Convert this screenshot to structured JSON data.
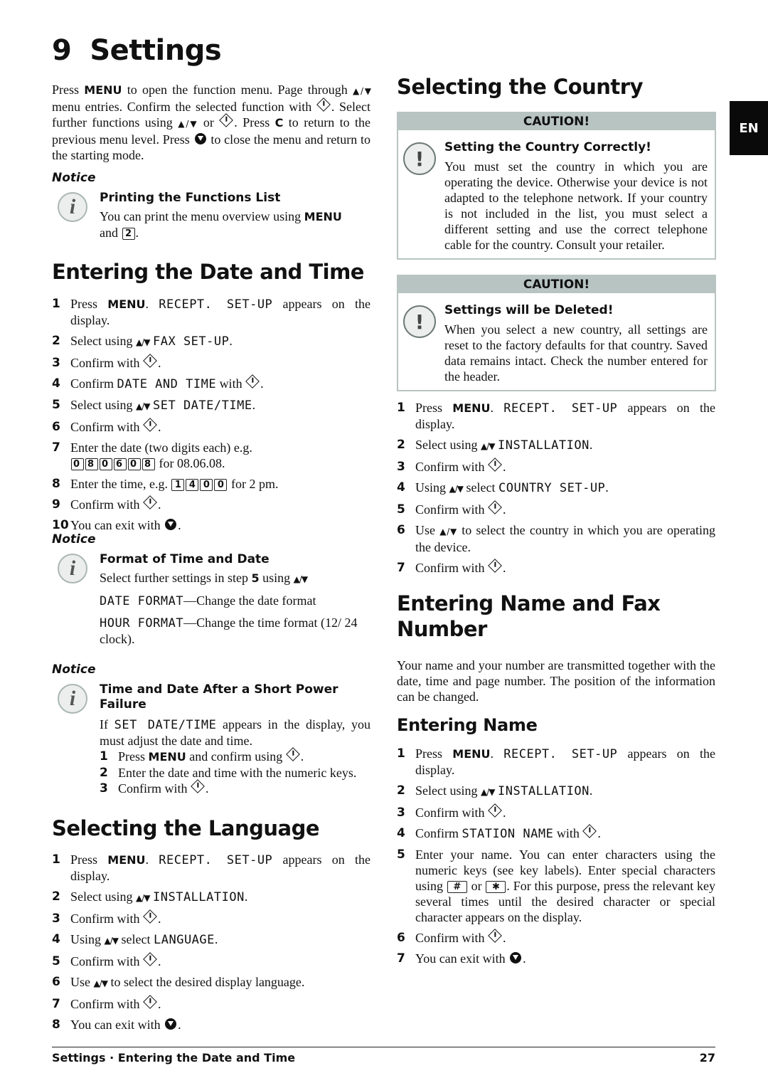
{
  "chapter": {
    "number": "9",
    "title": "Settings"
  },
  "language_tab": "EN",
  "icons": {
    "nav_arrows": "▲/▼",
    "ok": "ok-diamond-icon",
    "stop": "stop-icon",
    "info": "i",
    "warning": "!"
  },
  "intro": {
    "parts": [
      "Press ",
      "MENU",
      " to open the function menu. Page through ",
      " menu entries. Confirm the selected function with ",
      ". Select further functions using ",
      " or ",
      ". Press ",
      "C",
      " to return to the previous menu level. Press ",
      " to close the menu and return to the starting mode."
    ]
  },
  "notice_label": "Notice",
  "notice_functions_list": {
    "title": "Printing the Functions List",
    "text_before": "You can print the menu overview using ",
    "kw": "MENU",
    "text_mid": " and ",
    "key": "2",
    "text_after": "."
  },
  "date_time": {
    "heading": "Entering the Date and Time",
    "steps": [
      {
        "n": "1",
        "a": "Press ",
        "kw": "MENU",
        "b": ". ",
        "lcd": "RECEPT.  SET-UP",
        "c": " appears on the display."
      },
      {
        "n": "2",
        "a": "Select using ",
        "lcd": "FAX SET-UP",
        "c": "."
      },
      {
        "n": "3",
        "a": "Confirm with ",
        "c": "."
      },
      {
        "n": "4",
        "a": "Confirm ",
        "lcd": "DATE AND TIME",
        "b": " with ",
        "c": "."
      },
      {
        "n": "5",
        "a": "Select using ",
        "lcd": "SET DATE/TIME",
        "c": "."
      },
      {
        "n": "6",
        "a": "Confirm with ",
        "c": "."
      },
      {
        "n": "7",
        "a": "Enter the date (two digits each) e.g. ",
        "keys": [
          "0",
          "8",
          "0",
          "6",
          "0",
          "8"
        ],
        "c": " for 08.06.08."
      },
      {
        "n": "8",
        "a": "Enter the time, e.g. ",
        "keys": [
          "1",
          "4",
          "0",
          "0"
        ],
        "c": " for 2 pm."
      },
      {
        "n": "9",
        "a": "Confirm with ",
        "c": "."
      },
      {
        "n": "10",
        "a": "You can exit with ",
        "c": "."
      }
    ]
  },
  "notice_format": {
    "title": "Format of Time and Date",
    "line1_a": "Select further settings in step ",
    "line1_step": "5",
    "line1_b": "  using ",
    "line2_lcd": "DATE FORMAT",
    "line2_text": "—Change the date format",
    "line3_lcd": "HOUR FORMAT",
    "line3_text": "—Change the time format (12/ 24 clock)."
  },
  "notice_power": {
    "title": "Time and Date After a Short Power Failure",
    "text_a": "If ",
    "lcd": "SET DATE/TIME",
    "text_b": " appears in the display, you must adjust the date and time.",
    "steps": [
      {
        "n": "1",
        "a": "Press ",
        "kw": "MENU",
        "b": " and confirm using ",
        "c": "."
      },
      {
        "n": "2",
        "a": "Enter the date and time with the numeric keys."
      },
      {
        "n": "3",
        "a": "Confirm with ",
        "c": "."
      }
    ]
  },
  "language": {
    "heading": "Selecting the Language",
    "steps": [
      {
        "n": "1",
        "a": "Press ",
        "kw": "MENU",
        "b": ". ",
        "lcd": "RECEPT.  SET-UP",
        "c": " appears on the display."
      },
      {
        "n": "2",
        "a": "Select using ",
        "lcd": "INSTALLATION",
        "c": "."
      },
      {
        "n": "3",
        "a": "Confirm with ",
        "c": "."
      },
      {
        "n": "4",
        "a": "Using ",
        "b": " select ",
        "lcd": "LANGUAGE",
        "c": "."
      },
      {
        "n": "5",
        "a": "Confirm with ",
        "c": "."
      },
      {
        "n": "6",
        "a": "Use ",
        "c": " to select the desired display language."
      },
      {
        "n": "7",
        "a": "Confirm with ",
        "c": "."
      },
      {
        "n": "8",
        "a": "You can exit with ",
        "c": "."
      }
    ]
  },
  "country": {
    "heading": "Selecting the Country",
    "caution1": {
      "header": "CAUTION!",
      "title": "Setting the Country Correctly!",
      "text": "You must set the country in which you are operating the device. Otherwise your device is not adapted to the telephone network. If your country is not included in the list, you must select a different setting and use the correct telephone cable for the country. Consult your retailer."
    },
    "caution2": {
      "header": "CAUTION!",
      "title": "Settings will be Deleted!",
      "text": "When you select a new country, all settings are reset to the factory defaults for that country. Saved data remains intact. Check the number entered for the header."
    },
    "steps": [
      {
        "n": "1",
        "a": "Press ",
        "kw": "MENU",
        "b": ". ",
        "lcd": "RECEPT.  SET-UP",
        "c": " appears on the display."
      },
      {
        "n": "2",
        "a": "Select using ",
        "lcd": "INSTALLATION",
        "c": "."
      },
      {
        "n": "3",
        "a": "Confirm with ",
        "c": "."
      },
      {
        "n": "4",
        "a": "Using ",
        "b": " select ",
        "lcd": "COUNTRY SET-UP",
        "c": "."
      },
      {
        "n": "5",
        "a": "Confirm with ",
        "c": "."
      },
      {
        "n": "6",
        "a": "Use ",
        "c": " to select the country in which you are operating the device."
      },
      {
        "n": "7",
        "a": "Confirm with ",
        "c": "."
      }
    ]
  },
  "name_fax": {
    "heading": "Entering Name and Fax Number",
    "intro": "Your name and your number are transmitted together with the date, time and page number. The position of the information can be changed.",
    "subheading": "Entering Name",
    "steps": [
      {
        "n": "1",
        "a": "Press ",
        "kw": "MENU",
        "b": ". ",
        "lcd": "RECEPT.  SET-UP",
        "c": " appears on the display."
      },
      {
        "n": "2",
        "a": "Select using ",
        "lcd": "INSTALLATION",
        "c": "."
      },
      {
        "n": "3",
        "a": "Confirm with ",
        "c": "."
      },
      {
        "n": "4",
        "a": "Confirm ",
        "lcd": "STATION NAME",
        "b": " with ",
        "c": "."
      },
      {
        "n": "5",
        "a": "Enter your name. You can enter characters using the numeric keys (see key labels).   Enter special characters using ",
        "key1": "#",
        "mid": " or ",
        "key2": "✱",
        "c": ". For this purpose, press the relevant key several times until the desired character or special character appears on the display."
      },
      {
        "n": "6",
        "a": "Confirm with ",
        "c": "."
      },
      {
        "n": "7",
        "a": "You can exit with ",
        "c": "."
      }
    ]
  },
  "footer": {
    "breadcrumb": "Settings · Entering the Date and Time",
    "page_number": "27"
  }
}
